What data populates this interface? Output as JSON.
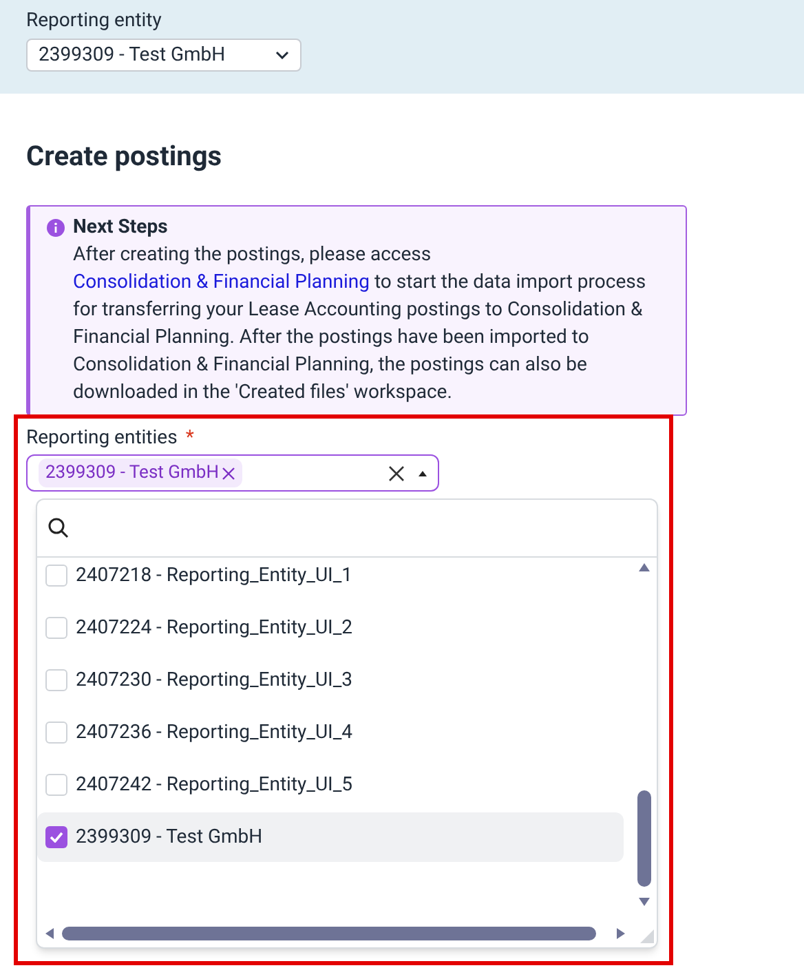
{
  "header": {
    "label": "Reporting entity",
    "select_value": "2399309 - Test GmbH"
  },
  "heading": "Create postings",
  "notice": {
    "title": "Next Steps",
    "body": [
      {
        "kind": "text",
        "text": "After creating the postings, please access "
      },
      {
        "kind": "link",
        "text": "Consolidation & Financial Planning"
      },
      {
        "kind": "text",
        "text": " to start the data import process for transferring your Lease Accounting postings to Consolidation & Financial Planning. After the postings have been imported to Consolidation & Financial Planning, the postings can also be downloaded in the 'Created files' workspace."
      }
    ]
  },
  "field": {
    "label": "Reporting entities",
    "required_mark": "*",
    "chips": [
      "2399309 - Test GmbH"
    ],
    "expanded": true
  },
  "options": [
    {
      "label": "2407218 - Reporting_Entity_UI_1",
      "checked": false,
      "selected": false
    },
    {
      "label": "2407224 - Reporting_Entity_UI_2",
      "checked": false,
      "selected": false
    },
    {
      "label": "2407230 - Reporting_Entity_UI_3",
      "checked": false,
      "selected": false
    },
    {
      "label": "2407236 - Reporting_Entity_UI_4",
      "checked": false,
      "selected": false
    },
    {
      "label": "2407242 - Reporting_Entity_UI_5",
      "checked": false,
      "selected": false
    },
    {
      "label": "2399309 - Test GmbH",
      "checked": true,
      "selected": true
    }
  ]
}
